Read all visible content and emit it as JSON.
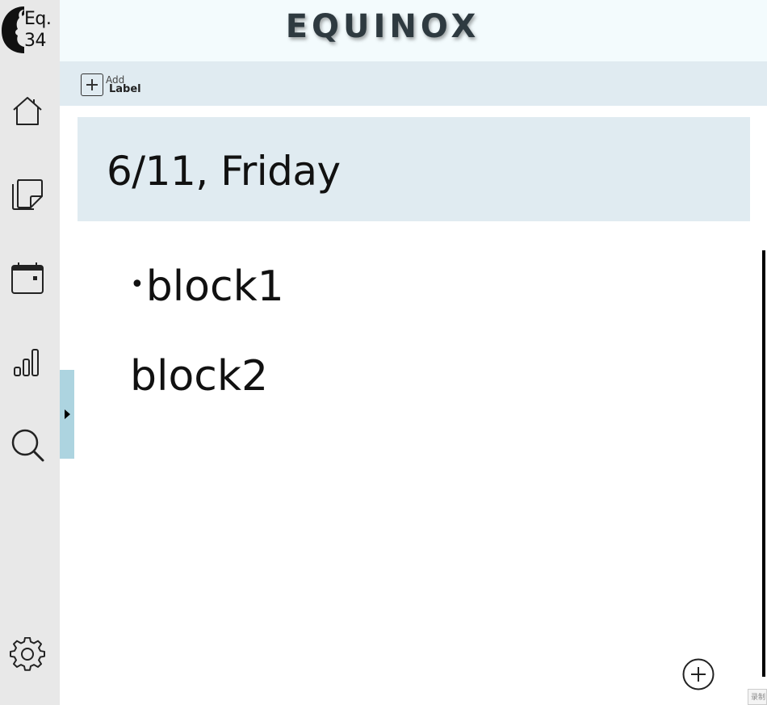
{
  "app": {
    "title": "EQUINOX",
    "logo_text_line1": "Eq.",
    "logo_text_line2": "34"
  },
  "sidebar": {
    "items": [
      {
        "name": "home",
        "icon": "home-icon"
      },
      {
        "name": "notes",
        "icon": "sticky-note-icon"
      },
      {
        "name": "calendar",
        "icon": "calendar-icon"
      },
      {
        "name": "stats",
        "icon": "bar-chart-icon"
      },
      {
        "name": "search",
        "icon": "search-icon"
      }
    ],
    "settings_icon": "gear-icon"
  },
  "label_bar": {
    "add_label_small": "Add",
    "add_label_big": "Label"
  },
  "page": {
    "date_heading": "6/11, Friday",
    "blocks": [
      {
        "bullet": "•",
        "text": "block1"
      },
      {
        "text": "block2"
      }
    ]
  },
  "corner": {
    "text": "录制"
  }
}
